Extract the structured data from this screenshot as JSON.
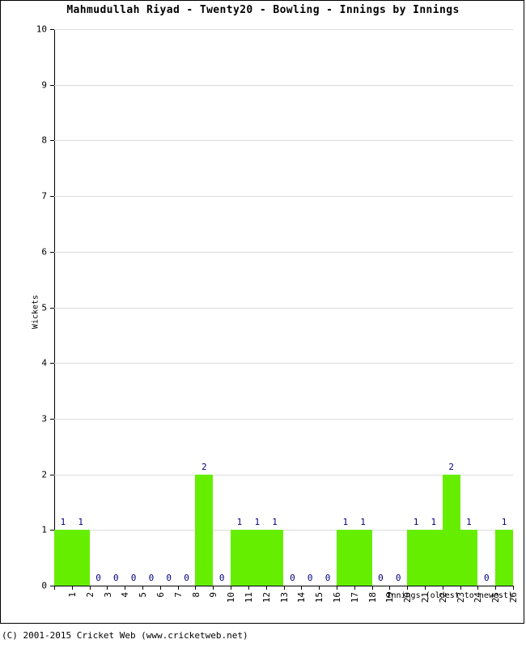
{
  "chart_data": {
    "type": "bar",
    "title": "Mahmudullah Riyad - Twenty20 - Bowling - Innings by Innings",
    "xlabel": "Innings (oldest to newest)",
    "ylabel": "Wickets",
    "categories": [
      "1",
      "2",
      "3",
      "4",
      "5",
      "6",
      "7",
      "8",
      "9",
      "10",
      "11",
      "12",
      "13",
      "14",
      "15",
      "16",
      "17",
      "18",
      "19",
      "20",
      "21",
      "22",
      "23",
      "24",
      "25",
      "26"
    ],
    "values": [
      1,
      1,
      0,
      0,
      0,
      0,
      0,
      0,
      2,
      0,
      1,
      1,
      1,
      0,
      0,
      0,
      1,
      1,
      0,
      0,
      1,
      1,
      2,
      1,
      0,
      1
    ],
    "value_labels": [
      "1",
      "1",
      "0",
      "0",
      "0",
      "0",
      "0",
      "0",
      "2",
      "0",
      "1",
      "1",
      "1",
      "0",
      "0",
      "0",
      "1",
      "1",
      "0",
      "0",
      "1",
      "1",
      "2",
      "1",
      "0",
      "1"
    ],
    "ylim": [
      0,
      10
    ],
    "ytick_labels": [
      "0",
      "1",
      "2",
      "3",
      "4",
      "5",
      "6",
      "7",
      "8",
      "9",
      "10"
    ],
    "ytick_values": [
      0,
      1,
      2,
      3,
      4,
      5,
      6,
      7,
      8,
      9,
      10
    ],
    "grid": true,
    "legend": null,
    "bar_color": "#66ee00",
    "label_color": "#000080",
    "grid_color": "#dddddd",
    "axis_color": "#000000"
  },
  "footer": {
    "copyright": "(C) 2001-2015 Cricket Web (www.cricketweb.net)"
  }
}
